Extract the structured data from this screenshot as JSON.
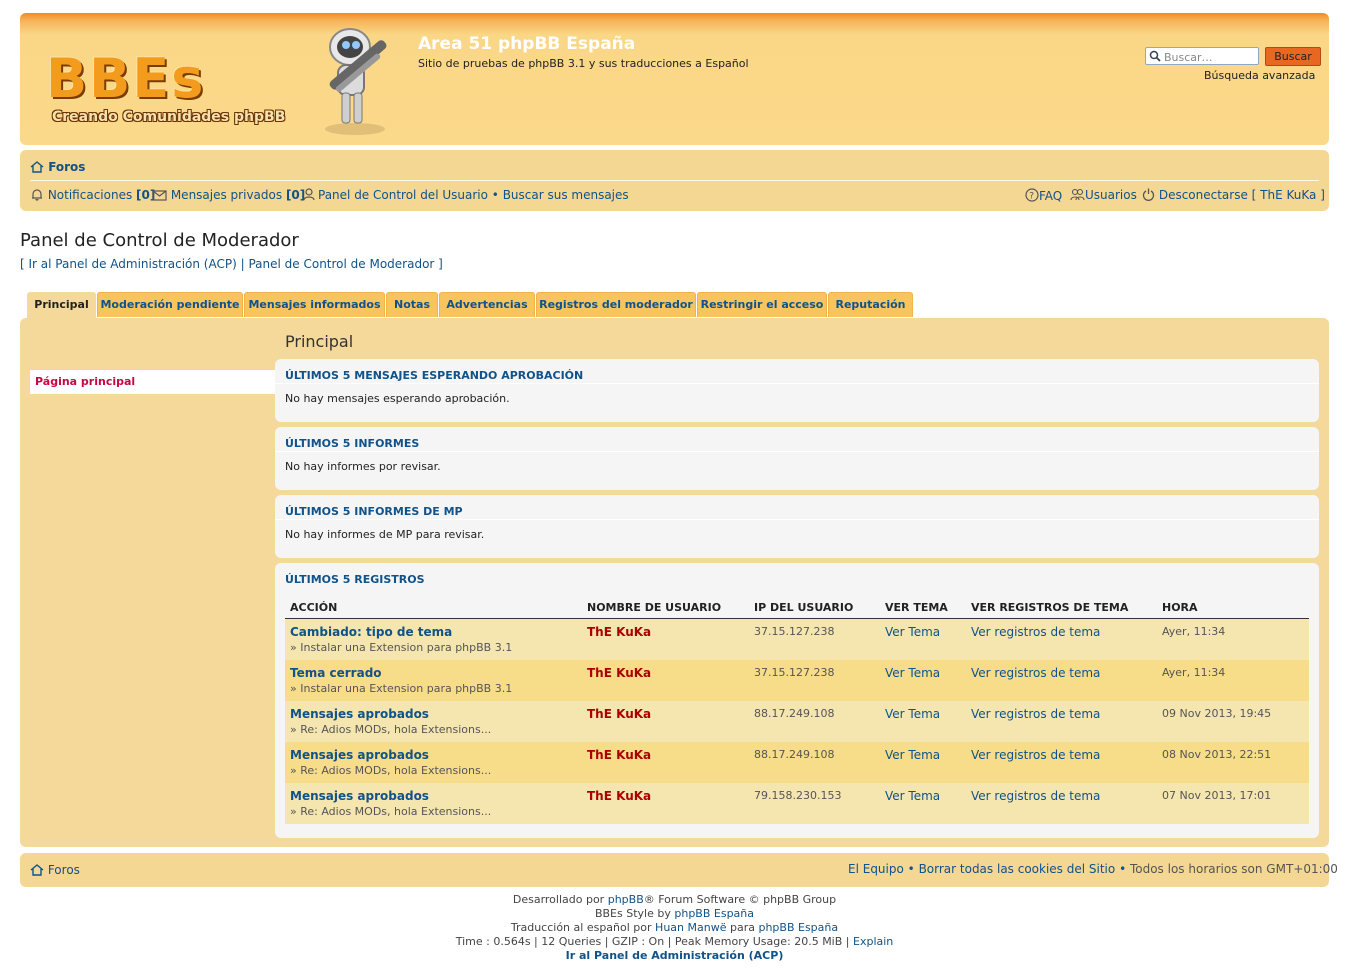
{
  "header": {
    "logo_text": "BBEs",
    "logo_subtitle": "Creando Comunidades phpBB",
    "site_title": "Area 51 phpBB España",
    "site_description": "Sitio de pruebas de phpBB 3.1 y sus traducciones a Español",
    "search_placeholder": "Buscar…",
    "search_button": "Buscar",
    "advanced_search": "Búsqueda avanzada",
    "accent_color": "#f08a23"
  },
  "navbar": {
    "breadcrumb_home": "Foros",
    "notifications_label": "Notificaciones",
    "notifications_count": "[0]",
    "pm_label": "Mensajes privados",
    "pm_count": "[0]",
    "ucp_label": "Panel de Control del Usuario",
    "bullet": "•",
    "own_posts": "Buscar sus mensajes",
    "faq": "FAQ",
    "members": "Usuarios",
    "logout": "Desconectarse [ ThE KuKa ]"
  },
  "page": {
    "title": "Panel de Control de Moderador",
    "acp_link": "Ir al Panel de Administración (ACP)",
    "mcp_link": "Panel de Control de Moderador"
  },
  "tabs": [
    "Principal",
    "Moderación pendiente",
    "Mensajes informados",
    "Notas",
    "Advertencias",
    "Registros del moderador",
    "Restringir el acceso",
    "Reputación"
  ],
  "sidebar": {
    "item": "Página principal"
  },
  "main": {
    "heading": "Principal",
    "box1": {
      "title": "ÚLTIMOS 5 MENSAJES ESPERANDO APROBACIÓN",
      "text": "No hay mensajes esperando aprobación."
    },
    "box2": {
      "title": "ÚLTIMOS 5 INFORMES",
      "text": "No hay informes por revisar."
    },
    "box3": {
      "title": "ÚLTIMOS 5 INFORMES DE MP",
      "text": "No hay informes de MP para revisar."
    },
    "box4": {
      "title": "ÚLTIMOS 5 REGISTROS"
    }
  },
  "logs": {
    "columns": [
      "ACCIÓN",
      "NOMBRE DE USUARIO",
      "IP DEL USUARIO",
      "VER TEMA",
      "VER REGISTROS DE TEMA",
      "HORA"
    ],
    "rows": [
      {
        "action": "Cambiado: tipo de tema",
        "topic": "» Instalar una Extension para phpBB 3.1",
        "user": "ThE KuKa",
        "ip": "37.15.127.238",
        "view": "Ver Tema",
        "logs": "Ver registros de tema",
        "time": "Ayer, 11:34"
      },
      {
        "action": "Tema cerrado",
        "topic": "» Instalar una Extension para phpBB 3.1",
        "user": "ThE KuKa",
        "ip": "37.15.127.238",
        "view": "Ver Tema",
        "logs": "Ver registros de tema",
        "time": "Ayer, 11:34"
      },
      {
        "action": "Mensajes aprobados",
        "topic": "» Re: Adios MODs, hola Extensions...",
        "user": "ThE KuKa",
        "ip": "88.17.249.108",
        "view": "Ver Tema",
        "logs": "Ver registros de tema",
        "time": "09 Nov 2013, 19:45"
      },
      {
        "action": "Mensajes aprobados",
        "topic": "» Re: Adios MODs, hola Extensions...",
        "user": "ThE KuKa",
        "ip": "88.17.249.108",
        "view": "Ver Tema",
        "logs": "Ver registros de tema",
        "time": "08 Nov 2013, 22:51"
      },
      {
        "action": "Mensajes aprobados",
        "topic": "» Re: Adios MODs, hola Extensions...",
        "user": "ThE KuKa",
        "ip": "79.158.230.153",
        "view": "Ver Tema",
        "logs": "Ver registros de tema",
        "time": "07 Nov 2013, 17:01"
      }
    ]
  },
  "footer": {
    "home": "Foros",
    "team": "El Equipo",
    "delete_cookies": "Borrar todas las cookies del Sitio",
    "timezone": "Todos los horarios son GMT+01:00",
    "powered_pre": "Desarrollado por",
    "powered_link": "phpBB",
    "powered_post": "® Forum Software © phpBB Group",
    "style_pre": "BBEs Style by",
    "style_link": "phpBB España",
    "translation_pre": "Traducción al español por",
    "translation_author": "Huan Manwë",
    "translation_mid": "para",
    "translation_link": "phpBB España",
    "debug": "Time : 0.564s | 12 Queries | GZIP : On | Peak Memory Usage: 20.5 MiB |",
    "explain": "Explain",
    "acp": "Ir al Panel de Administración (ACP)"
  }
}
